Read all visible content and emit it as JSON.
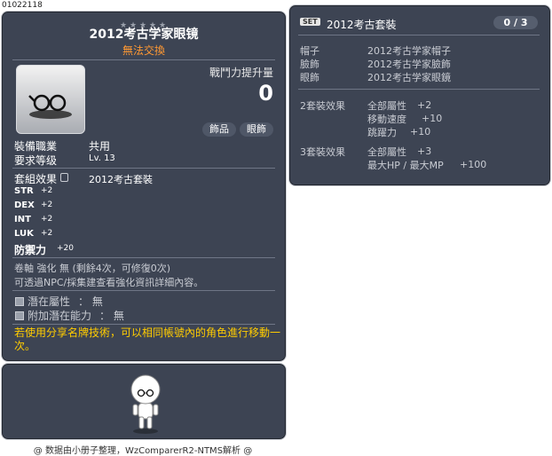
{
  "item_code": "01022118",
  "item": {
    "stars": [
      "★",
      "★",
      "★",
      "★",
      "★"
    ],
    "name": "2012考古学家眼镜",
    "tradable_note": "無法交換",
    "combat_power_label": "戰鬥力提升量",
    "combat_power_value": "0",
    "categories": [
      "飾品",
      "眼飾"
    ],
    "job_label": "裝備職業",
    "job_value": "共用",
    "level_label": "要求等级",
    "level_value": "Lv. 13",
    "set_effect_label": "套組效果",
    "set_effect_value": "2012考古套裝",
    "stats": [
      {
        "name": "STR",
        "value": "+2"
      },
      {
        "name": "DEX",
        "value": "+2"
      },
      {
        "name": "INT",
        "value": "+2"
      },
      {
        "name": "LUK",
        "value": "+2"
      }
    ],
    "defense_label": "防禦力",
    "defense_value": "+20",
    "scroll_text": "卷軸 強化 無 (剩餘4次，可修復0次)",
    "npc_text": "可透過NPC/採集建查看強化資訊詳細內容。",
    "potential_label": "潛在屬性",
    "potential_value": "： 無",
    "bonus_potential_label": "附加潛在能力",
    "bonus_potential_value": "： 無",
    "share_note": "若使用分享名牌技術，可以相同帳號內的角色進行移動一次。"
  },
  "set_panel": {
    "badge": "SET",
    "title": "2012考古套裝",
    "count": "0 / 3",
    "pieces": [
      {
        "slot": "帽子",
        "name": "2012考古学家帽子"
      },
      {
        "slot": "臉飾",
        "name": "2012考古学家臉飾"
      },
      {
        "slot": "眼飾",
        "name": "2012考古学家眼鏡"
      }
    ],
    "effects": [
      {
        "label": "2套裝效果",
        "lines": [
          {
            "name": "全部屬性",
            "value": "+2"
          },
          {
            "name": "移動速度",
            "value": "+10"
          },
          {
            "name": "跳躍力",
            "value": "+10"
          }
        ]
      },
      {
        "label": "3套裝效果",
        "lines": [
          {
            "name": "全部屬性",
            "value": "+3"
          },
          {
            "name": "最大HP / 最大MP",
            "value": "+100"
          }
        ]
      }
    ]
  },
  "footer": "@ 数据由小册子整理，WzComparerR2-NTMS解析 @",
  "colors": {
    "panel": "#3d4453",
    "gold": "#ffb300",
    "orange": "#ff9933",
    "yellow": "#ffcc00"
  },
  "icons": {
    "item": "glasses-icon",
    "lock": "lock-icon",
    "character": "character-preview"
  }
}
